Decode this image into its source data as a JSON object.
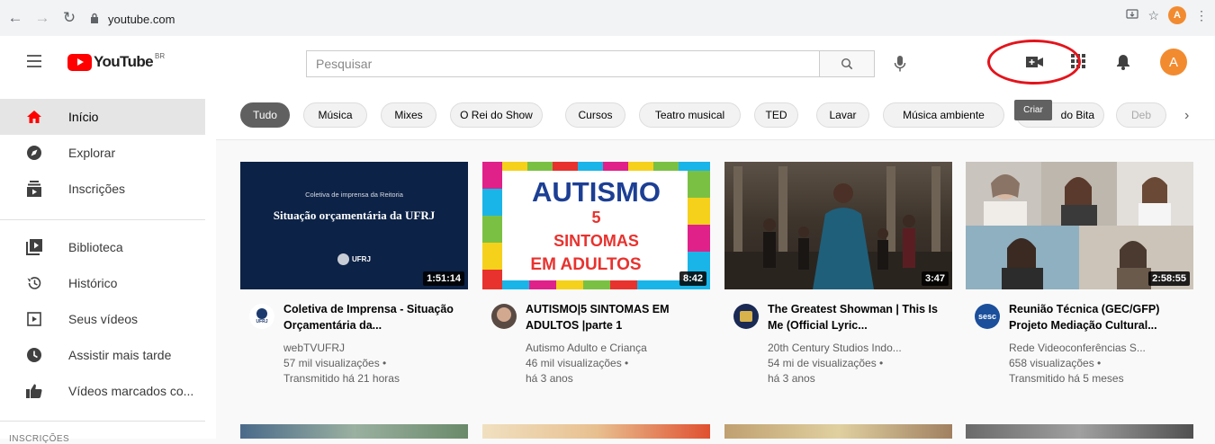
{
  "browser": {
    "url": "youtube.com",
    "avatar_letter": "A"
  },
  "header": {
    "logo_text": "YouTube",
    "logo_region": "BR",
    "search_placeholder": "Pesquisar",
    "avatar_letter": "A",
    "create_tooltip": "Criar"
  },
  "sidebar": {
    "items": [
      {
        "label": "Início",
        "icon": "home-icon",
        "active": true
      },
      {
        "label": "Explorar",
        "icon": "compass-icon"
      },
      {
        "label": "Inscrições",
        "icon": "subscriptions-icon"
      },
      {
        "label": "Biblioteca",
        "icon": "library-icon"
      },
      {
        "label": "Histórico",
        "icon": "history-icon"
      },
      {
        "label": "Seus vídeos",
        "icon": "your-videos-icon"
      },
      {
        "label": "Assistir mais tarde",
        "icon": "clock-icon"
      },
      {
        "label": "Vídeos marcados co...",
        "icon": "thumbs-up-icon"
      }
    ],
    "section_title": "INSCRIÇÕES"
  },
  "chips": [
    {
      "label": "Tudo",
      "active": true
    },
    {
      "label": "Música"
    },
    {
      "label": "Mixes"
    },
    {
      "label": "O Rei do Show"
    },
    {
      "label": "Cursos"
    },
    {
      "label": "Teatro musical"
    },
    {
      "label": "TED"
    },
    {
      "label": "Lavar"
    },
    {
      "label": "Música ambiente"
    },
    {
      "label": "do Bita"
    },
    {
      "label": "Deb"
    }
  ],
  "videos": [
    {
      "title": "Coletiva de Imprensa - Situação Orçamentária da...",
      "channel": "webTVUFRJ",
      "views": "57 mil visualizações •",
      "age": "Transmitido há 21 horas",
      "duration": "1:51:14",
      "thumb_line1": "Coletiva de imprensa da Reitoria",
      "thumb_line2": "Situação orçamentária da UFRJ",
      "thumb_logo": "UFRJ",
      "avatar_text": "UFRJ"
    },
    {
      "title": "AUTISMO|5 SINTOMAS EM ADULTOS |parte 1",
      "channel": "Autismo Adulto e Criança",
      "views": "46 mil visualizações •",
      "age": "há 3 anos",
      "duration": "8:42",
      "thumb_line1": "AUTISMO",
      "thumb_line2": "5",
      "thumb_line3": "SINTOMAS",
      "thumb_line4": "EM ADULTOS"
    },
    {
      "title": "The Greatest Showman | This Is Me (Official Lyric...",
      "channel": "20th Century Studios Indo...",
      "views": "54 mi de visualizações •",
      "age": "há 3 anos",
      "duration": "3:47"
    },
    {
      "title": "Reunião Técnica (GEC/GFP) Projeto Mediação Cultural...",
      "channel": "Rede Videoconferências S...",
      "views": "658 visualizações •",
      "age": "Transmitido há 5 meses",
      "duration": "2:58:55",
      "avatar_text": "sesc"
    }
  ]
}
